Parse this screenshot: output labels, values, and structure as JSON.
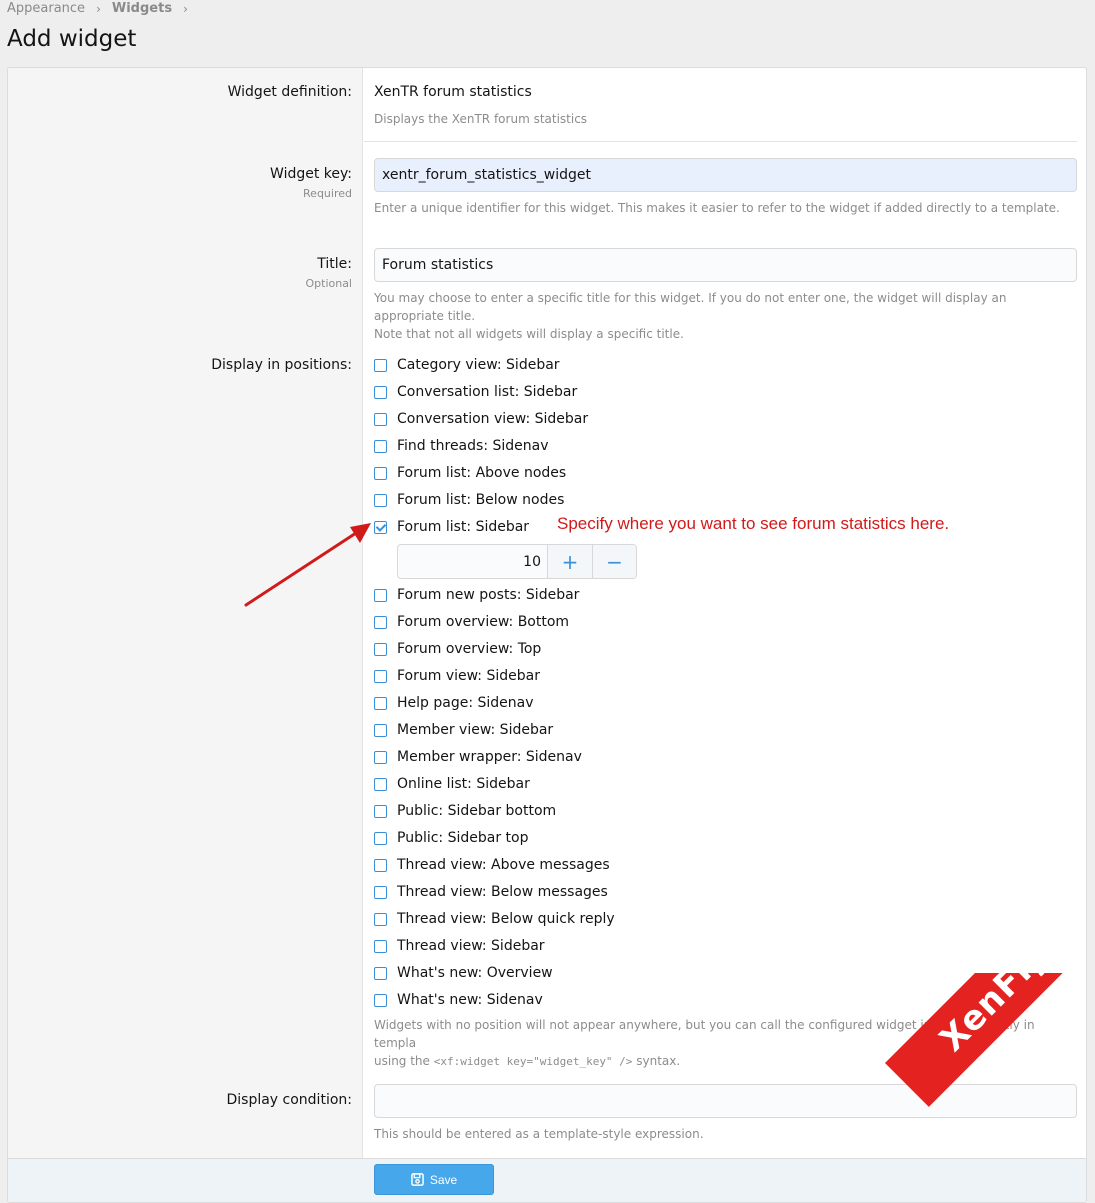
{
  "breadcrumb": {
    "items": [
      "Appearance",
      "Widgets"
    ]
  },
  "page_title": "Add widget",
  "form": {
    "widget_definition": {
      "label": "Widget definition:",
      "value": "XenTR forum statistics",
      "hint": "Displays the XenTR forum statistics"
    },
    "widget_key": {
      "label": "Widget key:",
      "sublabel": "Required",
      "value": "xentr_forum_statistics_widget",
      "hint": "Enter a unique identifier for this widget. This makes it easier to refer to the widget if added directly to a template."
    },
    "title": {
      "label": "Title:",
      "sublabel": "Optional",
      "value": "Forum statistics",
      "hint_line1": "You may choose to enter a specific title for this widget. If you do not enter one, the widget will display an appropriate title.",
      "hint_line2": "Note that not all widgets will display a specific title."
    },
    "positions": {
      "label": "Display in positions:",
      "items": [
        {
          "label": "Category view: Sidebar",
          "checked": false
        },
        {
          "label": "Conversation list: Sidebar",
          "checked": false
        },
        {
          "label": "Conversation view: Sidebar",
          "checked": false
        },
        {
          "label": "Find threads: Sidenav",
          "checked": false
        },
        {
          "label": "Forum list: Above nodes",
          "checked": false
        },
        {
          "label": "Forum list: Below nodes",
          "checked": false
        },
        {
          "label": "Forum list: Sidebar",
          "checked": true
        },
        {
          "label": "Forum new posts: Sidebar",
          "checked": false
        },
        {
          "label": "Forum overview: Bottom",
          "checked": false
        },
        {
          "label": "Forum overview: Top",
          "checked": false
        },
        {
          "label": "Forum view: Sidebar",
          "checked": false
        },
        {
          "label": "Help page: Sidenav",
          "checked": false
        },
        {
          "label": "Member view: Sidebar",
          "checked": false
        },
        {
          "label": "Member wrapper: Sidenav",
          "checked": false
        },
        {
          "label": "Online list: Sidebar",
          "checked": false
        },
        {
          "label": "Public: Sidebar bottom",
          "checked": false
        },
        {
          "label": "Public: Sidebar top",
          "checked": false
        },
        {
          "label": "Thread view: Above messages",
          "checked": false
        },
        {
          "label": "Thread view: Below messages",
          "checked": false
        },
        {
          "label": "Thread view: Below quick reply",
          "checked": false
        },
        {
          "label": "Thread view: Sidebar",
          "checked": false
        },
        {
          "label": "What's new: Overview",
          "checked": false
        },
        {
          "label": "What's new: Sidenav",
          "checked": false
        }
      ],
      "order_value": "10",
      "stepper_plus": "+",
      "stepper_minus": "−",
      "hint_line1": "Widgets with no position will not appear anywhere, but you can call the configured widget instance directly in templa",
      "hint_line2_pre": "using the ",
      "hint_code": "<xf:widget key=\"widget_key\" />",
      "hint_line2_post": " syntax."
    },
    "display_condition": {
      "label": "Display condition:",
      "value": "",
      "hint": "This should be entered as a template-style expression."
    }
  },
  "annotation": "Specify where you want to see forum statistics here.",
  "save_label": "Save",
  "watermark": "XenFiy.com",
  "colors": {
    "accent": "#3a8fd6",
    "button": "#47a7eb",
    "annotation": "#d11a1a",
    "watermark": "#e4221f"
  }
}
